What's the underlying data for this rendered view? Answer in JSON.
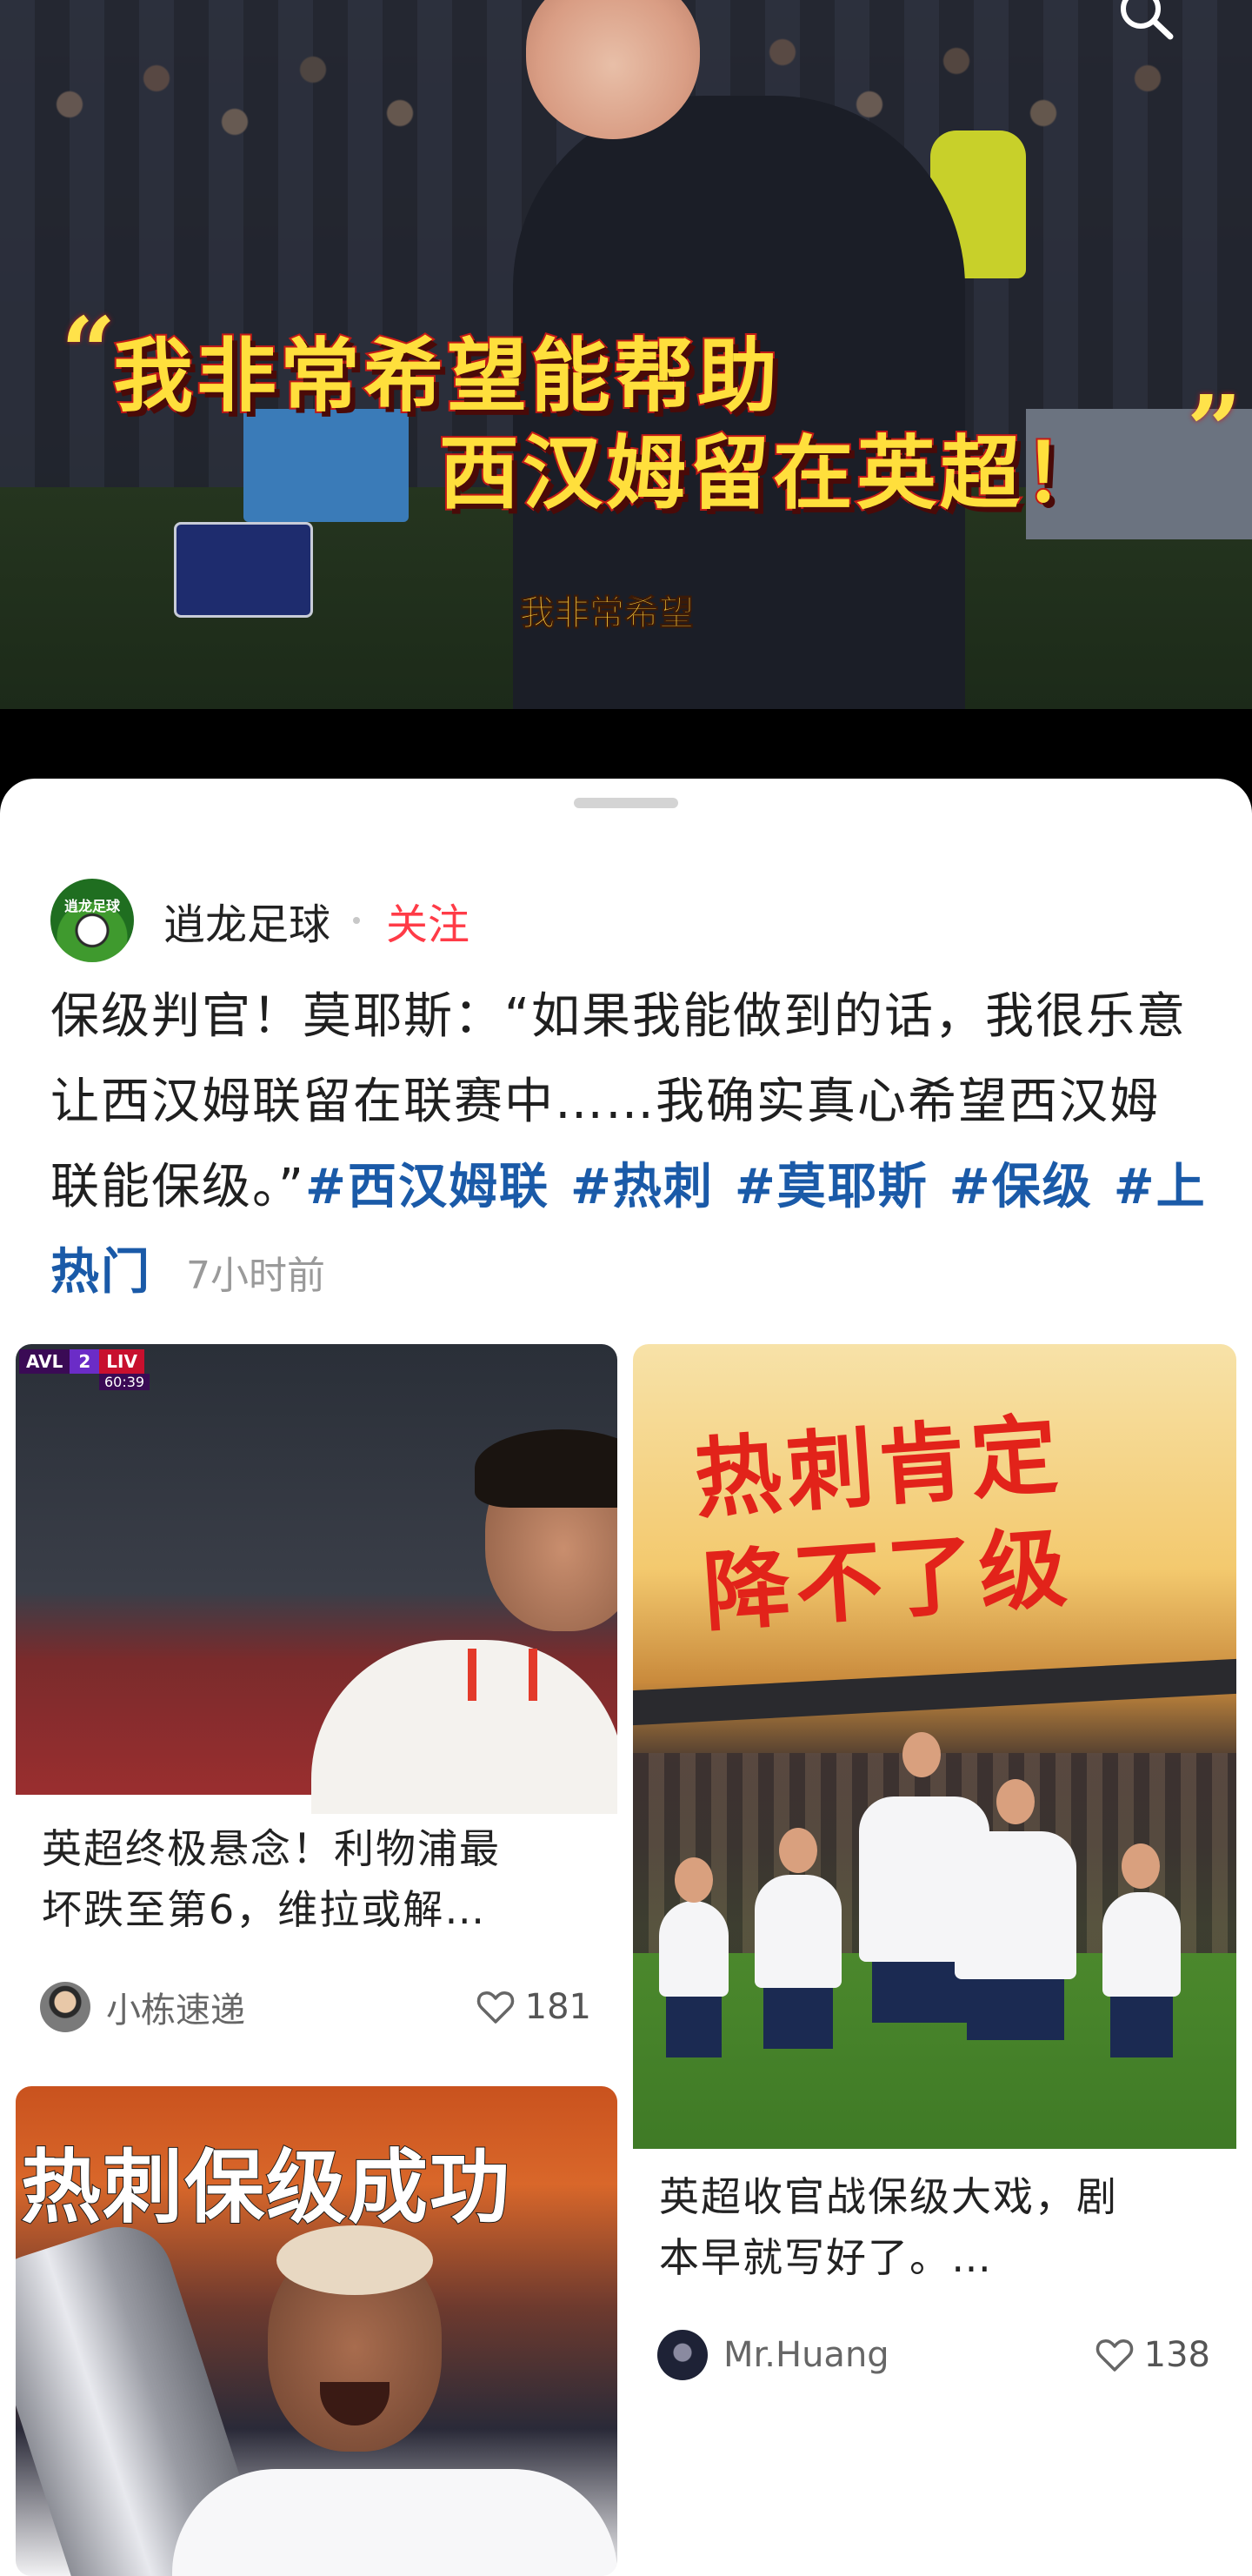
{
  "video": {
    "headline_line1": "我非常希望能帮助",
    "headline_line2": "西汉姆留在英超！",
    "quote_open": "“",
    "quote_close": "”",
    "subtitle": "我非常希望",
    "search_icon": "search-icon"
  },
  "post": {
    "author": "逍龙足球",
    "avatar_text": "逍龙足球",
    "follow_label": "关注",
    "text": "保级判官！莫耶斯：“如果我能做到的话，我很乐意让西汉姆联留在联赛中……我确实真心希望西汉姆联能保级。”",
    "tags": [
      "#西汉姆联",
      "#热刺",
      "#莫耶",
      "斯",
      "#保级",
      "#上热门"
    ],
    "time": "7小时前"
  },
  "cards": [
    {
      "title_line1": "英超终极悬念！利物浦最",
      "title_line2": "坏跌至第6，维拉或解…",
      "author": "小栋速递",
      "likes": "181",
      "scorebug": {
        "home": "AVL",
        "score": "2",
        "away": "LIV",
        "clock": "60:39"
      }
    },
    {
      "image_caption_line1": "热刺肯定",
      "image_caption_line2": "降不了级",
      "title_line1": "英超收官战保级大戏，剧",
      "title_line2": "本早就写好了。…",
      "author": "Mr.Huang",
      "likes": "138"
    },
    {
      "image_caption": "热刺保级成功"
    }
  ],
  "colors": {
    "follow": "#ff3b47",
    "hashtag": "#1a5aa8",
    "headline_fill": "#ffdf3c",
    "headline_stroke": "#c21a16",
    "caption_red": "#e2231a"
  }
}
